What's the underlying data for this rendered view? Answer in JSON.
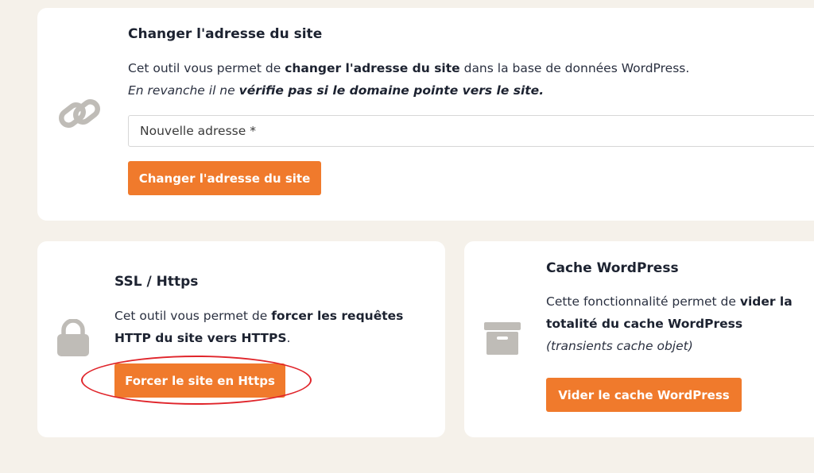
{
  "url_card": {
    "title": "Changer l'adresse du site",
    "line1_a": "Cet outil vous permet de ",
    "line1_b": "changer l'adresse du site",
    "line1_c": " dans la base de données WordPress.",
    "line2_a": "En revanche il ne ",
    "line2_b": "vérifie pas si le domaine pointe vers le site.",
    "input_placeholder": "Nouvelle adresse *",
    "button_label": "Changer l'adresse du site",
    "icon": "link-icon"
  },
  "ssl_card": {
    "title": "SSL / Https",
    "desc_a": "Cet outil vous permet de ",
    "desc_b": "forcer les requêtes HTTP du site vers HTTPS",
    "desc_c": ".",
    "button_label": "Forcer le site en Https",
    "icon": "lock-icon"
  },
  "cache_card": {
    "title": "Cache WordPress",
    "desc_a": "Cette fonctionnalité permet de ",
    "desc_b": "vider la totalité du cache WordPress",
    "desc_c": " (transients cache objet)",
    "button_label": "Vider le cache WordPress",
    "icon": "archive-box-icon"
  },
  "colors": {
    "accent": "#f07a2c",
    "background": "#f5f1ea",
    "annotation": "#e0252b"
  }
}
